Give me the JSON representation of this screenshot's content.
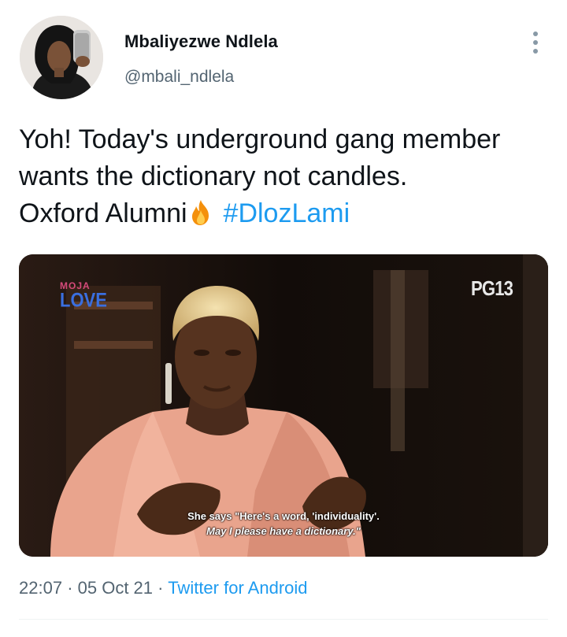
{
  "tweet": {
    "author": {
      "display_name": "Mbaliyezwe Ndlela",
      "handle": "@mbali_ndlela",
      "avatar_icon": "user-avatar-photo"
    },
    "more_icon": "more-options-vertical-icon",
    "text_lines": [
      "Yoh! Today's underground gang member",
      "wants the dictionary not candles."
    ],
    "text_line3_prefix": "Oxford Alumni",
    "emoji": "fire-emoji",
    "hashtag": "#DlozLami",
    "media": {
      "brand_top": "MOJA",
      "brand_bottom": "LOVE",
      "rating": "PG13",
      "subtitle_line1": "She says \"Here's a word, 'individuality'.",
      "subtitle_line2": "May I please have a dictionary.\""
    },
    "time": "22:07",
    "date": "05 Oct 21",
    "separator": "·",
    "source": "Twitter for Android"
  },
  "colors": {
    "link": "#1d9bf0",
    "secondary_text": "#536471",
    "primary_text": "#0f1419"
  }
}
